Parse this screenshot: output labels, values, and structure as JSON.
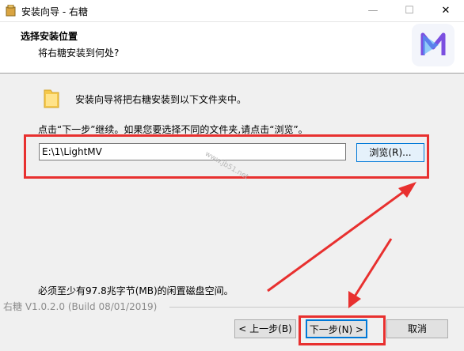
{
  "window": {
    "title": "安装向导 - 右糖",
    "min_glyph": "—",
    "max_glyph": "☐",
    "close_glyph": "✕"
  },
  "header": {
    "title": "选择安装位置",
    "subtitle": "将右糖安装到何处?"
  },
  "body": {
    "intro": "安装向导将把右糖安装到以下文件夹中。",
    "instruction": "点击“下一步”继续。如果您要选择不同的文件夹,请点击“浏览”。",
    "path_value": "E:\\1\\LightMV",
    "browse_label": "浏览(R)...",
    "space_note": "必须至少有97.8兆字节(MB)的闲置磁盘空间。",
    "watermark": "www.jb51.net"
  },
  "footer": {
    "version": "右糖 V1.0.2.0 (Build 08/01/2019)",
    "back_label": "< 上一步(B)",
    "next_label": "下一步(N) >",
    "cancel_label": "取消"
  },
  "colors": {
    "accent": "#0078d7",
    "annotation": "#e8302f",
    "brand": "#7b4fe0"
  },
  "icons": {
    "app": "installer-icon",
    "folder": "folder-icon",
    "logo": "lightmv-logo-icon"
  }
}
